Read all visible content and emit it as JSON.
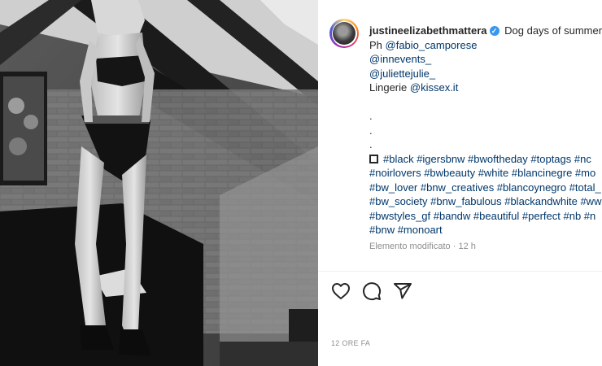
{
  "post": {
    "username": "justineelizabethmattera",
    "verified_icon": "✓",
    "caption_first": "Dog days of summer.",
    "lines": [
      {
        "prefix": "Ph ",
        "mention": "@fabio_camporese"
      },
      {
        "prefix": "",
        "mention": "@innevents_"
      },
      {
        "prefix": "",
        "mention": "@juliettejulie_"
      },
      {
        "prefix": "Lingerie ",
        "mention": "@kissex.it"
      }
    ],
    "dots": [
      ".",
      ".",
      "."
    ],
    "hashtag_lines": [
      "#black #igersbnw #bwoftheday #toptags #nc",
      "#noirlovers #bwbeauty #white #blancinegre #mo",
      "#bw_lover #bnw_creatives #blancoynegro #total_",
      "#bw_society #bnw_fabulous #blackandwhite #ww",
      "#bwstyles_gf #bandw #beautiful #perfect #nb #n",
      "#bnw #monoart"
    ],
    "edited_label": "Elemento modificato",
    "edited_time": "12 h",
    "time_ago": "12 ORE FA"
  },
  "icons": {
    "like": "heart-icon",
    "comment": "comment-icon",
    "share": "paper-plane-icon",
    "checkbox": "square-icon"
  },
  "colors": {
    "link": "#00376b",
    "muted": "#8e8e8e",
    "verified": "#3897f0",
    "text": "#262626"
  }
}
